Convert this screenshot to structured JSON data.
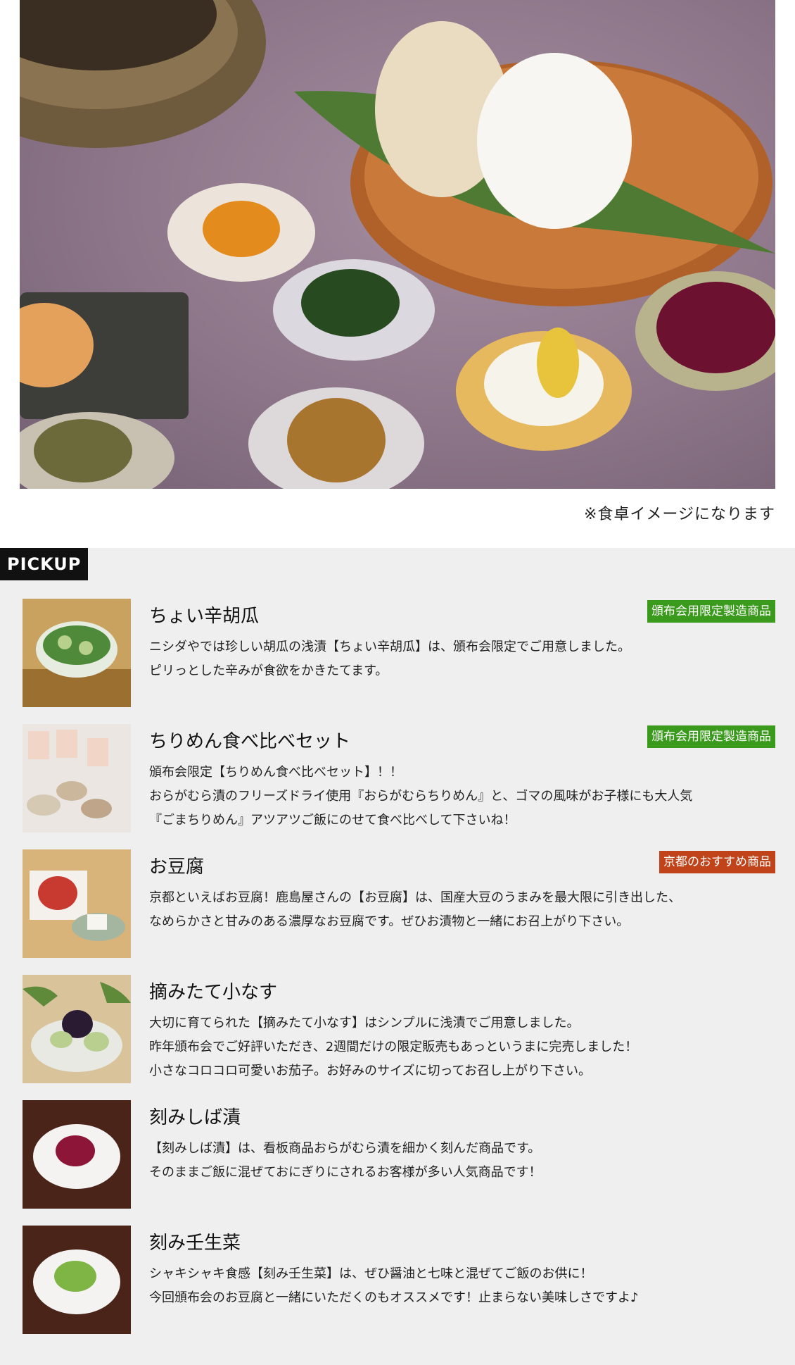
{
  "hero": {
    "alt_icon": "food-table-photo",
    "caption": "※食卓イメージになります"
  },
  "pickup": {
    "label": "PICKUP",
    "items": [
      {
        "title": "ちょい辛胡瓜",
        "badge": "頒布会用限定製造商品",
        "badge_color": "#3a9a1c",
        "lines": [
          "ニシダやでは珍しい胡瓜の浅漬【ちょい辛胡瓜】は、頒布会限定でご用意しました。",
          "ピリっとした辛みが食欲をかきたてます。"
        ]
      },
      {
        "title": "ちりめん食べ比べセット",
        "badge": "頒布会用限定製造商品",
        "badge_color": "#3a9a1c",
        "lines": [
          "頒布会限定【ちりめん食べ比べセット】！！",
          "おらがむら漬のフリーズドライ使用『おらがむらちりめん』と、ゴマの風味がお子様にも大人気",
          "『ごまちりめん』アツアツご飯にのせて食べ比べして下さいね！"
        ]
      },
      {
        "title": "お豆腐",
        "badge": "京都のおすすめ商品",
        "badge_color": "#c0431a",
        "lines": [
          "京都といえばお豆腐！鹿島屋さんの【お豆腐】は、国産大豆のうまみを最大限に引き出した、",
          "なめらかさと甘みのある濃厚なお豆腐です。ぜひお漬物と一緒にお召上がり下さい。"
        ]
      },
      {
        "title": "摘みたて小なす",
        "badge": "",
        "lines": [
          "大切に育てられた【摘みたて小なす】はシンプルに浅漬でご用意しました。",
          "昨年頒布会でご好評いただき、2週間だけの限定販売もあっというまに完売しました！",
          "小さなコロコロ可愛いお茄子。お好みのサイズに切ってお召し上がり下さい。"
        ]
      },
      {
        "title": "刻みしば漬",
        "badge": "",
        "lines": [
          "【刻みしば漬】は、看板商品おらがむら漬を細かく刻んだ商品です。",
          "そのままご飯に混ぜておにぎりにされるお客様が多い人気商品です！"
        ]
      },
      {
        "title": "刻み壬生菜",
        "badge": "",
        "lines": [
          "シャキシャキ食感【刻み壬生菜】は、ぜひ醤油と七味と混ぜてご飯のお供に！",
          "今回頒布会のお豆腐と一緒にいただくのもオススメです！止まらない美味しさですよ♪"
        ]
      }
    ]
  }
}
